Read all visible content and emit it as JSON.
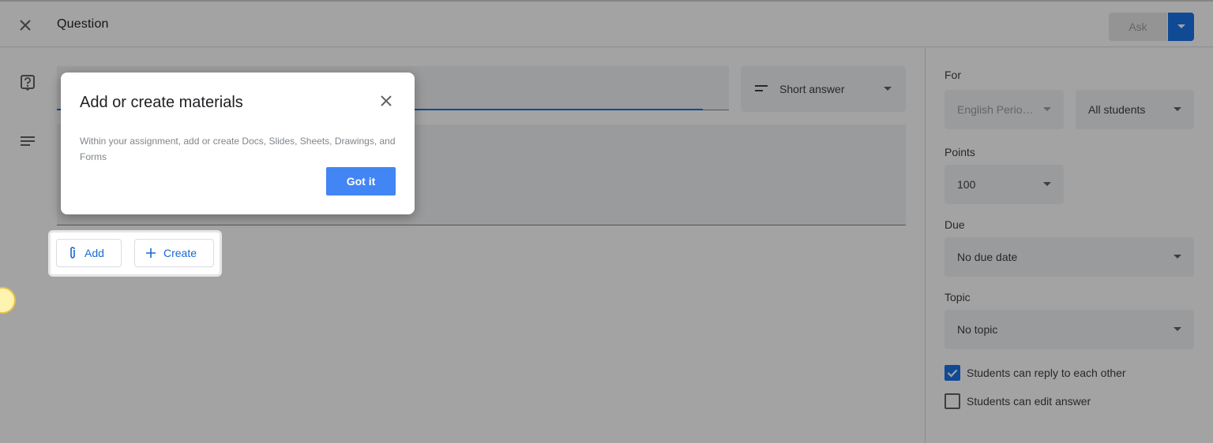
{
  "header": {
    "title": "Question",
    "ask_label": "Ask"
  },
  "question": {
    "type_label": "Short answer"
  },
  "attach": {
    "add_label": "Add",
    "create_label": "Create"
  },
  "dialog": {
    "title": "Add or create materials",
    "body": "Within your assignment, add or create Docs, Slides, Sheets, Drawings, and Forms",
    "button_label": "Got it"
  },
  "sidebar": {
    "for_label": "For",
    "class_value": "English Perio…",
    "students_value": "All students",
    "points_label": "Points",
    "points_value": "100",
    "due_label": "Due",
    "due_value": "No due date",
    "topic_label": "Topic",
    "topic_value": "No topic",
    "reply_label": "Students can reply to each other",
    "reply_checked": true,
    "edit_label": "Students can edit answer",
    "edit_checked": false
  },
  "colors": {
    "accent": "#1a73e8",
    "button_blue": "#4285f4"
  },
  "icons": [
    "close-icon",
    "question-icon",
    "description-icon",
    "short-answer-icon",
    "dropdown-icon",
    "paperclip-icon",
    "plus-icon"
  ]
}
